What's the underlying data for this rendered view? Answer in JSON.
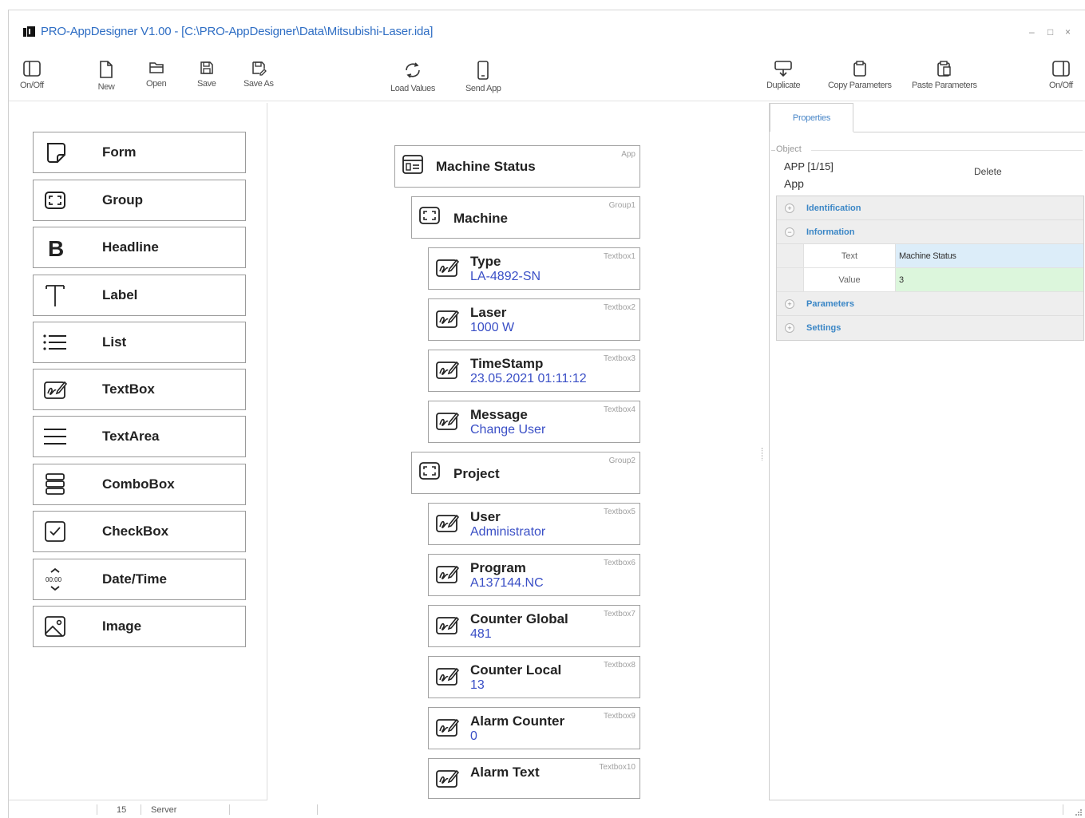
{
  "window": {
    "title": "PRO-AppDesigner V1.00 - [C:\\PRO-AppDesigner\\Data\\Mitsubishi-Laser.ida]",
    "controls": {
      "minimize": "–",
      "maximize": "□",
      "close": "×"
    }
  },
  "toolbar": {
    "onoff_left": "On/Off",
    "new": "New",
    "open": "Open",
    "save": "Save",
    "save_as": "Save As",
    "load_values": "Load Values",
    "send_app": "Send App",
    "duplicate": "Duplicate",
    "copy_params": "Copy Parameters",
    "paste_params": "Paste Parameters",
    "onoff_right": "On/Off"
  },
  "palette": [
    {
      "label": "Form",
      "icon": "form-icon"
    },
    {
      "label": "Group",
      "icon": "group-icon"
    },
    {
      "label": "Headline",
      "icon": "headline-icon"
    },
    {
      "label": "Label",
      "icon": "label-icon"
    },
    {
      "label": "List",
      "icon": "list-icon"
    },
    {
      "label": "TextBox",
      "icon": "textbox-icon"
    },
    {
      "label": "TextArea",
      "icon": "textarea-icon"
    },
    {
      "label": "ComboBox",
      "icon": "combobox-icon"
    },
    {
      "label": "CheckBox",
      "icon": "checkbox-icon"
    },
    {
      "label": "Date/Time",
      "icon": "datetime-icon"
    },
    {
      "label": "Image",
      "icon": "image-icon"
    }
  ],
  "tree": {
    "app": {
      "title": "Machine Status",
      "tag": "App"
    },
    "group1": {
      "title": "Machine",
      "tag": "Group1"
    },
    "group2": {
      "title": "Project",
      "tag": "Group2"
    },
    "textboxes": [
      {
        "title": "Type",
        "value": "LA-4892-SN",
        "tag": "Textbox1"
      },
      {
        "title": "Laser",
        "value": "1000 W",
        "tag": "Textbox2"
      },
      {
        "title": "TimeStamp",
        "value": "23.05.2021 01:11:12",
        "tag": "Textbox3"
      },
      {
        "title": "Message",
        "value": "Change User",
        "tag": "Textbox4"
      },
      {
        "title": "User",
        "value": "Administrator",
        "tag": "Textbox5"
      },
      {
        "title": "Program",
        "value": "A137144.NC",
        "tag": "Textbox6"
      },
      {
        "title": "Counter Global",
        "value": "481",
        "tag": "Textbox7"
      },
      {
        "title": "Counter Local",
        "value": "13",
        "tag": "Textbox8"
      },
      {
        "title": "Alarm Counter",
        "value": "0",
        "tag": "Textbox9"
      },
      {
        "title": "Alarm Text",
        "value": "",
        "tag": "Textbox10"
      }
    ]
  },
  "properties": {
    "tab": "Properties",
    "object_legend": "Object",
    "object_id": "APP  [1/15]",
    "object_type": "App",
    "delete": "Delete",
    "categories": {
      "identification": "Identification",
      "information": "Information",
      "parameters": "Parameters",
      "settings": "Settings"
    },
    "rows": [
      {
        "name": "Text",
        "value": "Machine Status"
      },
      {
        "name": "Value",
        "value": "3"
      }
    ]
  },
  "colors": {
    "title_blue": "#2f6ec4",
    "value_blue": "#3a4fc6",
    "category_blue": "#3a86c6",
    "row_text_bg": "#dcedf9",
    "row_value_bg": "#dcf6dc"
  },
  "statusbar": {
    "count": "15",
    "mode": "Server"
  }
}
